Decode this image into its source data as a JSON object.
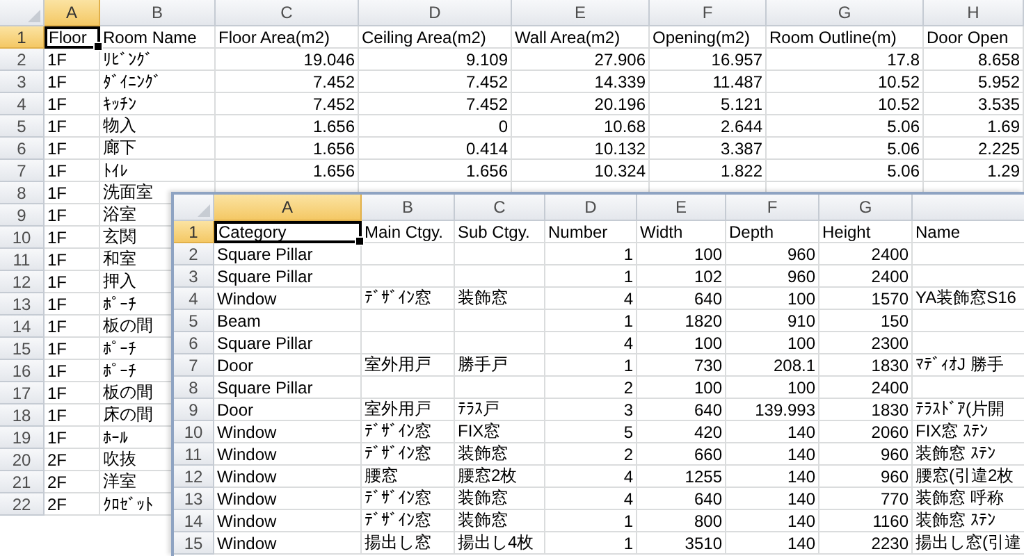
{
  "sheets": [
    {
      "columns": [
        {
          "letter": "A",
          "kind": "text",
          "selected": true
        },
        {
          "letter": "B",
          "kind": "text",
          "selected": false
        },
        {
          "letter": "C",
          "kind": "number",
          "selected": false
        },
        {
          "letter": "D",
          "kind": "number",
          "selected": false
        },
        {
          "letter": "E",
          "kind": "number",
          "selected": false
        },
        {
          "letter": "F",
          "kind": "number",
          "selected": false
        },
        {
          "letter": "G",
          "kind": "number",
          "selected": false
        },
        {
          "letter": "H",
          "kind": "number",
          "selected": false
        }
      ],
      "rows": [
        {
          "number": "1",
          "kind": "heading",
          "selected": true,
          "cells": [
            "Floor",
            "Room Name",
            "Floor Area(m2)",
            "Ceiling Area(m2)",
            "Wall Area(m2)",
            "Opening(m2)",
            "Room Outline(m)",
            "Door Open"
          ]
        },
        {
          "number": "2",
          "kind": "data",
          "selected": false,
          "cells": [
            "1F",
            "ﾘﾋﾞﾝｸﾞ",
            "19.046",
            "9.109",
            "27.906",
            "16.957",
            "17.8",
            "8.658"
          ]
        },
        {
          "number": "3",
          "kind": "data",
          "selected": false,
          "cells": [
            "1F",
            "ﾀﾞｲﾆﾝｸﾞ",
            "7.452",
            "7.452",
            "14.339",
            "11.487",
            "10.52",
            "5.952"
          ]
        },
        {
          "number": "4",
          "kind": "data",
          "selected": false,
          "cells": [
            "1F",
            "ｷｯﾁﾝ",
            "7.452",
            "7.452",
            "20.196",
            "5.121",
            "10.52",
            "3.535"
          ]
        },
        {
          "number": "5",
          "kind": "data",
          "selected": false,
          "cells": [
            "1F",
            "物入",
            "1.656",
            "0",
            "10.68",
            "2.644",
            "5.06",
            "1.69"
          ]
        },
        {
          "number": "6",
          "kind": "data",
          "selected": false,
          "cells": [
            "1F",
            "廊下",
            "1.656",
            "0.414",
            "10.132",
            "3.387",
            "5.06",
            "2.225"
          ]
        },
        {
          "number": "7",
          "kind": "data",
          "selected": false,
          "cells": [
            "1F",
            "ﾄｲﾚ",
            "1.656",
            "1.656",
            "10.324",
            "1.822",
            "5.06",
            "1.29"
          ]
        },
        {
          "number": "8",
          "kind": "data",
          "selected": false,
          "cells": [
            "1F",
            "洗面室"
          ]
        },
        {
          "number": "9",
          "kind": "data",
          "selected": false,
          "cells": [
            "1F",
            "浴室"
          ]
        },
        {
          "number": "10",
          "kind": "data",
          "selected": false,
          "cells": [
            "1F",
            "玄関"
          ]
        },
        {
          "number": "11",
          "kind": "data",
          "selected": false,
          "cells": [
            "1F",
            "和室"
          ]
        },
        {
          "number": "12",
          "kind": "data",
          "selected": false,
          "cells": [
            "1F",
            "押入"
          ]
        },
        {
          "number": "13",
          "kind": "data",
          "selected": false,
          "cells": [
            "1F",
            "ﾎﾟｰﾁ"
          ]
        },
        {
          "number": "14",
          "kind": "data",
          "selected": false,
          "cells": [
            "1F",
            "板の間"
          ]
        },
        {
          "number": "15",
          "kind": "data",
          "selected": false,
          "cells": [
            "1F",
            "ﾎﾟｰﾁ"
          ]
        },
        {
          "number": "16",
          "kind": "data",
          "selected": false,
          "cells": [
            "1F",
            "ﾎﾟｰﾁ"
          ]
        },
        {
          "number": "17",
          "kind": "data",
          "selected": false,
          "cells": [
            "1F",
            "板の間"
          ]
        },
        {
          "number": "18",
          "kind": "data",
          "selected": false,
          "cells": [
            "1F",
            "床の間"
          ]
        },
        {
          "number": "19",
          "kind": "data",
          "selected": false,
          "cells": [
            "1F",
            "ﾎｰﾙ"
          ]
        },
        {
          "number": "20",
          "kind": "data",
          "selected": false,
          "cells": [
            "2F",
            "吹抜"
          ]
        },
        {
          "number": "21",
          "kind": "data",
          "selected": false,
          "cells": [
            "2F",
            "洋室"
          ]
        },
        {
          "number": "22",
          "kind": "data",
          "selected": false,
          "cells": [
            "2F",
            "ｸﾛｾﾞｯﾄ"
          ]
        }
      ]
    },
    {
      "columns": [
        {
          "letter": "A",
          "kind": "text",
          "selected": true
        },
        {
          "letter": "B",
          "kind": "text",
          "selected": false
        },
        {
          "letter": "C",
          "kind": "text",
          "selected": false
        },
        {
          "letter": "D",
          "kind": "number",
          "selected": false
        },
        {
          "letter": "E",
          "kind": "number",
          "selected": false
        },
        {
          "letter": "F",
          "kind": "number",
          "selected": false
        },
        {
          "letter": "G",
          "kind": "number",
          "selected": false
        },
        {
          "kind": "text",
          "selected": false
        }
      ],
      "rows": [
        {
          "number": "1",
          "kind": "heading",
          "selected": true,
          "cells": [
            "Category",
            "Main Ctgy.",
            "Sub Ctgy.",
            "Number",
            "Width",
            "Depth",
            "Height",
            "Name"
          ]
        },
        {
          "number": "2",
          "kind": "data",
          "selected": false,
          "cells": [
            "Square Pillar",
            null,
            null,
            "1",
            "100",
            "960",
            "2400",
            null
          ]
        },
        {
          "number": "3",
          "kind": "data",
          "selected": false,
          "cells": [
            "Square Pillar",
            null,
            null,
            "1",
            "102",
            "960",
            "2400",
            null
          ]
        },
        {
          "number": "4",
          "kind": "data",
          "selected": false,
          "cells": [
            "Window",
            "ﾃﾞｻﾞｲﾝ窓",
            "装飾窓",
            "4",
            "640",
            "100",
            "1570",
            "YA装飾窓S16"
          ]
        },
        {
          "number": "5",
          "kind": "data",
          "selected": false,
          "cells": [
            "Beam",
            null,
            null,
            "1",
            "1820",
            "910",
            "150",
            null
          ]
        },
        {
          "number": "6",
          "kind": "data",
          "selected": false,
          "cells": [
            "Square Pillar",
            null,
            null,
            "4",
            "100",
            "100",
            "2300",
            null
          ]
        },
        {
          "number": "7",
          "kind": "data",
          "selected": false,
          "cells": [
            "Door",
            "室外用戸",
            "勝手戸",
            "1",
            "730",
            "208.1",
            "1830",
            "ﾏﾃﾞｨｵJ 勝手"
          ]
        },
        {
          "number": "8",
          "kind": "data",
          "selected": false,
          "cells": [
            "Square Pillar",
            null,
            null,
            "2",
            "100",
            "100",
            "2400",
            null
          ]
        },
        {
          "number": "9",
          "kind": "data",
          "selected": false,
          "cells": [
            "Door",
            "室外用戸",
            "ﾃﾗｽ戸",
            "3",
            "640",
            "139.993",
            "1830",
            "ﾃﾗｽﾄﾞｱ(片開"
          ]
        },
        {
          "number": "10",
          "kind": "data",
          "selected": false,
          "cells": [
            "Window",
            "ﾃﾞｻﾞｲﾝ窓",
            "FIX窓",
            "5",
            "420",
            "140",
            "2060",
            "FIX窓 ｽﾃﾝ"
          ]
        },
        {
          "number": "11",
          "kind": "data",
          "selected": false,
          "cells": [
            "Window",
            "ﾃﾞｻﾞｲﾝ窓",
            "装飾窓",
            "2",
            "660",
            "140",
            "960",
            "装飾窓 ｽﾃﾝ"
          ]
        },
        {
          "number": "12",
          "kind": "data",
          "selected": false,
          "cells": [
            "Window",
            "腰窓",
            "腰窓2枚",
            "4",
            "1255",
            "140",
            "960",
            "腰窓(引違2枚"
          ]
        },
        {
          "number": "13",
          "kind": "data",
          "selected": false,
          "cells": [
            "Window",
            "ﾃﾞｻﾞｲﾝ窓",
            "装飾窓",
            "4",
            "640",
            "140",
            "770",
            "装飾窓 呼称"
          ]
        },
        {
          "number": "14",
          "kind": "data",
          "selected": false,
          "cells": [
            "Window",
            "ﾃﾞｻﾞｲﾝ窓",
            "装飾窓",
            "1",
            "800",
            "140",
            "1160",
            "装飾窓 ｽﾃﾝ"
          ]
        },
        {
          "number": "15",
          "kind": "data",
          "selected": false,
          "cells": [
            "Window",
            "揚出し窓",
            "揚出し4枚",
            "1",
            "3510",
            "140",
            "2230",
            "揚出し窓(引違"
          ]
        }
      ]
    }
  ]
}
